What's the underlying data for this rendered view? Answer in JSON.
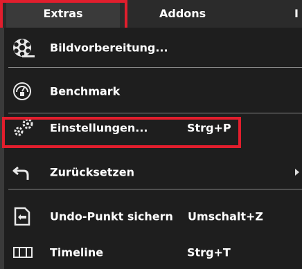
{
  "menubar": {
    "items": [
      {
        "label": "Extras"
      },
      {
        "label": "Addons"
      },
      {
        "label": "I"
      }
    ]
  },
  "menu": {
    "items": [
      {
        "label": "Bildvorbereitung...",
        "icon": "film-reel-icon"
      },
      {
        "label": "Benchmark",
        "icon": "speedometer-icon"
      },
      {
        "label": "Einstellungen...",
        "shortcut": "Strg+P",
        "icon": "gears-icon"
      },
      {
        "label": "Zurücksetzen",
        "icon": "undo-arrow-icon",
        "has_submenu": true
      },
      {
        "label": "Undo-Punkt sichern",
        "shortcut": "Umschalt+Z",
        "icon": "save-point-icon"
      },
      {
        "label": "Timeline",
        "shortcut": "Strg+T",
        "icon": "timeline-icon"
      }
    ]
  },
  "colors": {
    "background": "#1e1e1e",
    "menubar": "#2b2b2b",
    "highlight_box": "#e11e2d",
    "separator": "#8a8a8a"
  }
}
